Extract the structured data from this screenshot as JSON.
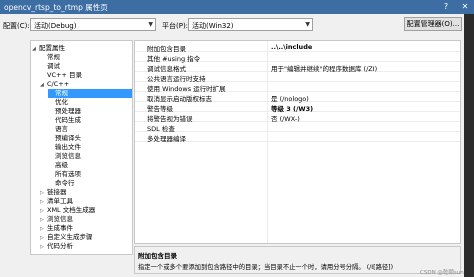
{
  "window": {
    "title": "opencv_rtsp_to_rtmp 属性页",
    "help_glyph": "?",
    "close_glyph": "✕"
  },
  "config_bar": {
    "config_label": "配置(C):",
    "config_value": "活动(Debug)",
    "platform_label": "平台(P):",
    "platform_value": "活动(Win32)",
    "config_manager_button": "配置管理器(O)..."
  },
  "tree": {
    "nodes": [
      {
        "label": "配置属性",
        "expander": "◢",
        "level": 0
      },
      {
        "label": "常规",
        "expander": "",
        "level": 1
      },
      {
        "label": "调试",
        "expander": "",
        "level": 1
      },
      {
        "label": "VC++ 目录",
        "expander": "",
        "level": 1
      },
      {
        "label": "C/C++",
        "expander": "◢",
        "level": 1
      },
      {
        "label": "常规",
        "expander": "",
        "level": 2,
        "selected": true
      },
      {
        "label": "优化",
        "expander": "",
        "level": 2
      },
      {
        "label": "预处理器",
        "expander": "",
        "level": 2
      },
      {
        "label": "代码生成",
        "expander": "",
        "level": 2
      },
      {
        "label": "语言",
        "expander": "",
        "level": 2
      },
      {
        "label": "预编译头",
        "expander": "",
        "level": 2
      },
      {
        "label": "输出文件",
        "expander": "",
        "level": 2
      },
      {
        "label": "浏览信息",
        "expander": "",
        "level": 2
      },
      {
        "label": "高级",
        "expander": "",
        "level": 2
      },
      {
        "label": "所有选项",
        "expander": "",
        "level": 2
      },
      {
        "label": "命令行",
        "expander": "",
        "level": 2
      },
      {
        "label": "链接器",
        "expander": "▷",
        "level": 1
      },
      {
        "label": "清单工具",
        "expander": "▷",
        "level": 1
      },
      {
        "label": "XML 文档生成器",
        "expander": "▷",
        "level": 1
      },
      {
        "label": "浏览信息",
        "expander": "▷",
        "level": 1
      },
      {
        "label": "生成事件",
        "expander": "▷",
        "level": 1
      },
      {
        "label": "自定义生成步骤",
        "expander": "▷",
        "level": 1
      },
      {
        "label": "代码分析",
        "expander": "▷",
        "level": 1
      }
    ]
  },
  "properties": {
    "rows": [
      {
        "key": "附加包含目录",
        "value": "..\\..\\include",
        "bold": true
      },
      {
        "key": "其他 #using 指令",
        "value": "",
        "bold": false
      },
      {
        "key": "调试信息格式",
        "value": "用于\"编辑并继续\"的程序数据库 (/ZI)",
        "bold": false
      },
      {
        "key": "公共语言运行时支持",
        "value": "",
        "bold": false
      },
      {
        "key": "使用 Windows 运行时扩展",
        "value": "",
        "bold": false
      },
      {
        "key": "取消显示启动版权标志",
        "value": "是 (/nologo)",
        "bold": false
      },
      {
        "key": "警告等级",
        "value": "等级 3 (/W3)",
        "bold": true
      },
      {
        "key": "将警告视为错误",
        "value": "否 (/WX-)",
        "bold": false
      },
      {
        "key": "SDL 检查",
        "value": "",
        "bold": false
      },
      {
        "key": "多处理器编译",
        "value": "",
        "bold": false
      }
    ]
  },
  "description": {
    "title": "附加包含目录",
    "text": "指定一个或多个要添加到包含路径中的目录；当目录不止一个时，请用分号分隔。     (/I[路径])"
  },
  "watermark": "CSDN @乾颐sun"
}
